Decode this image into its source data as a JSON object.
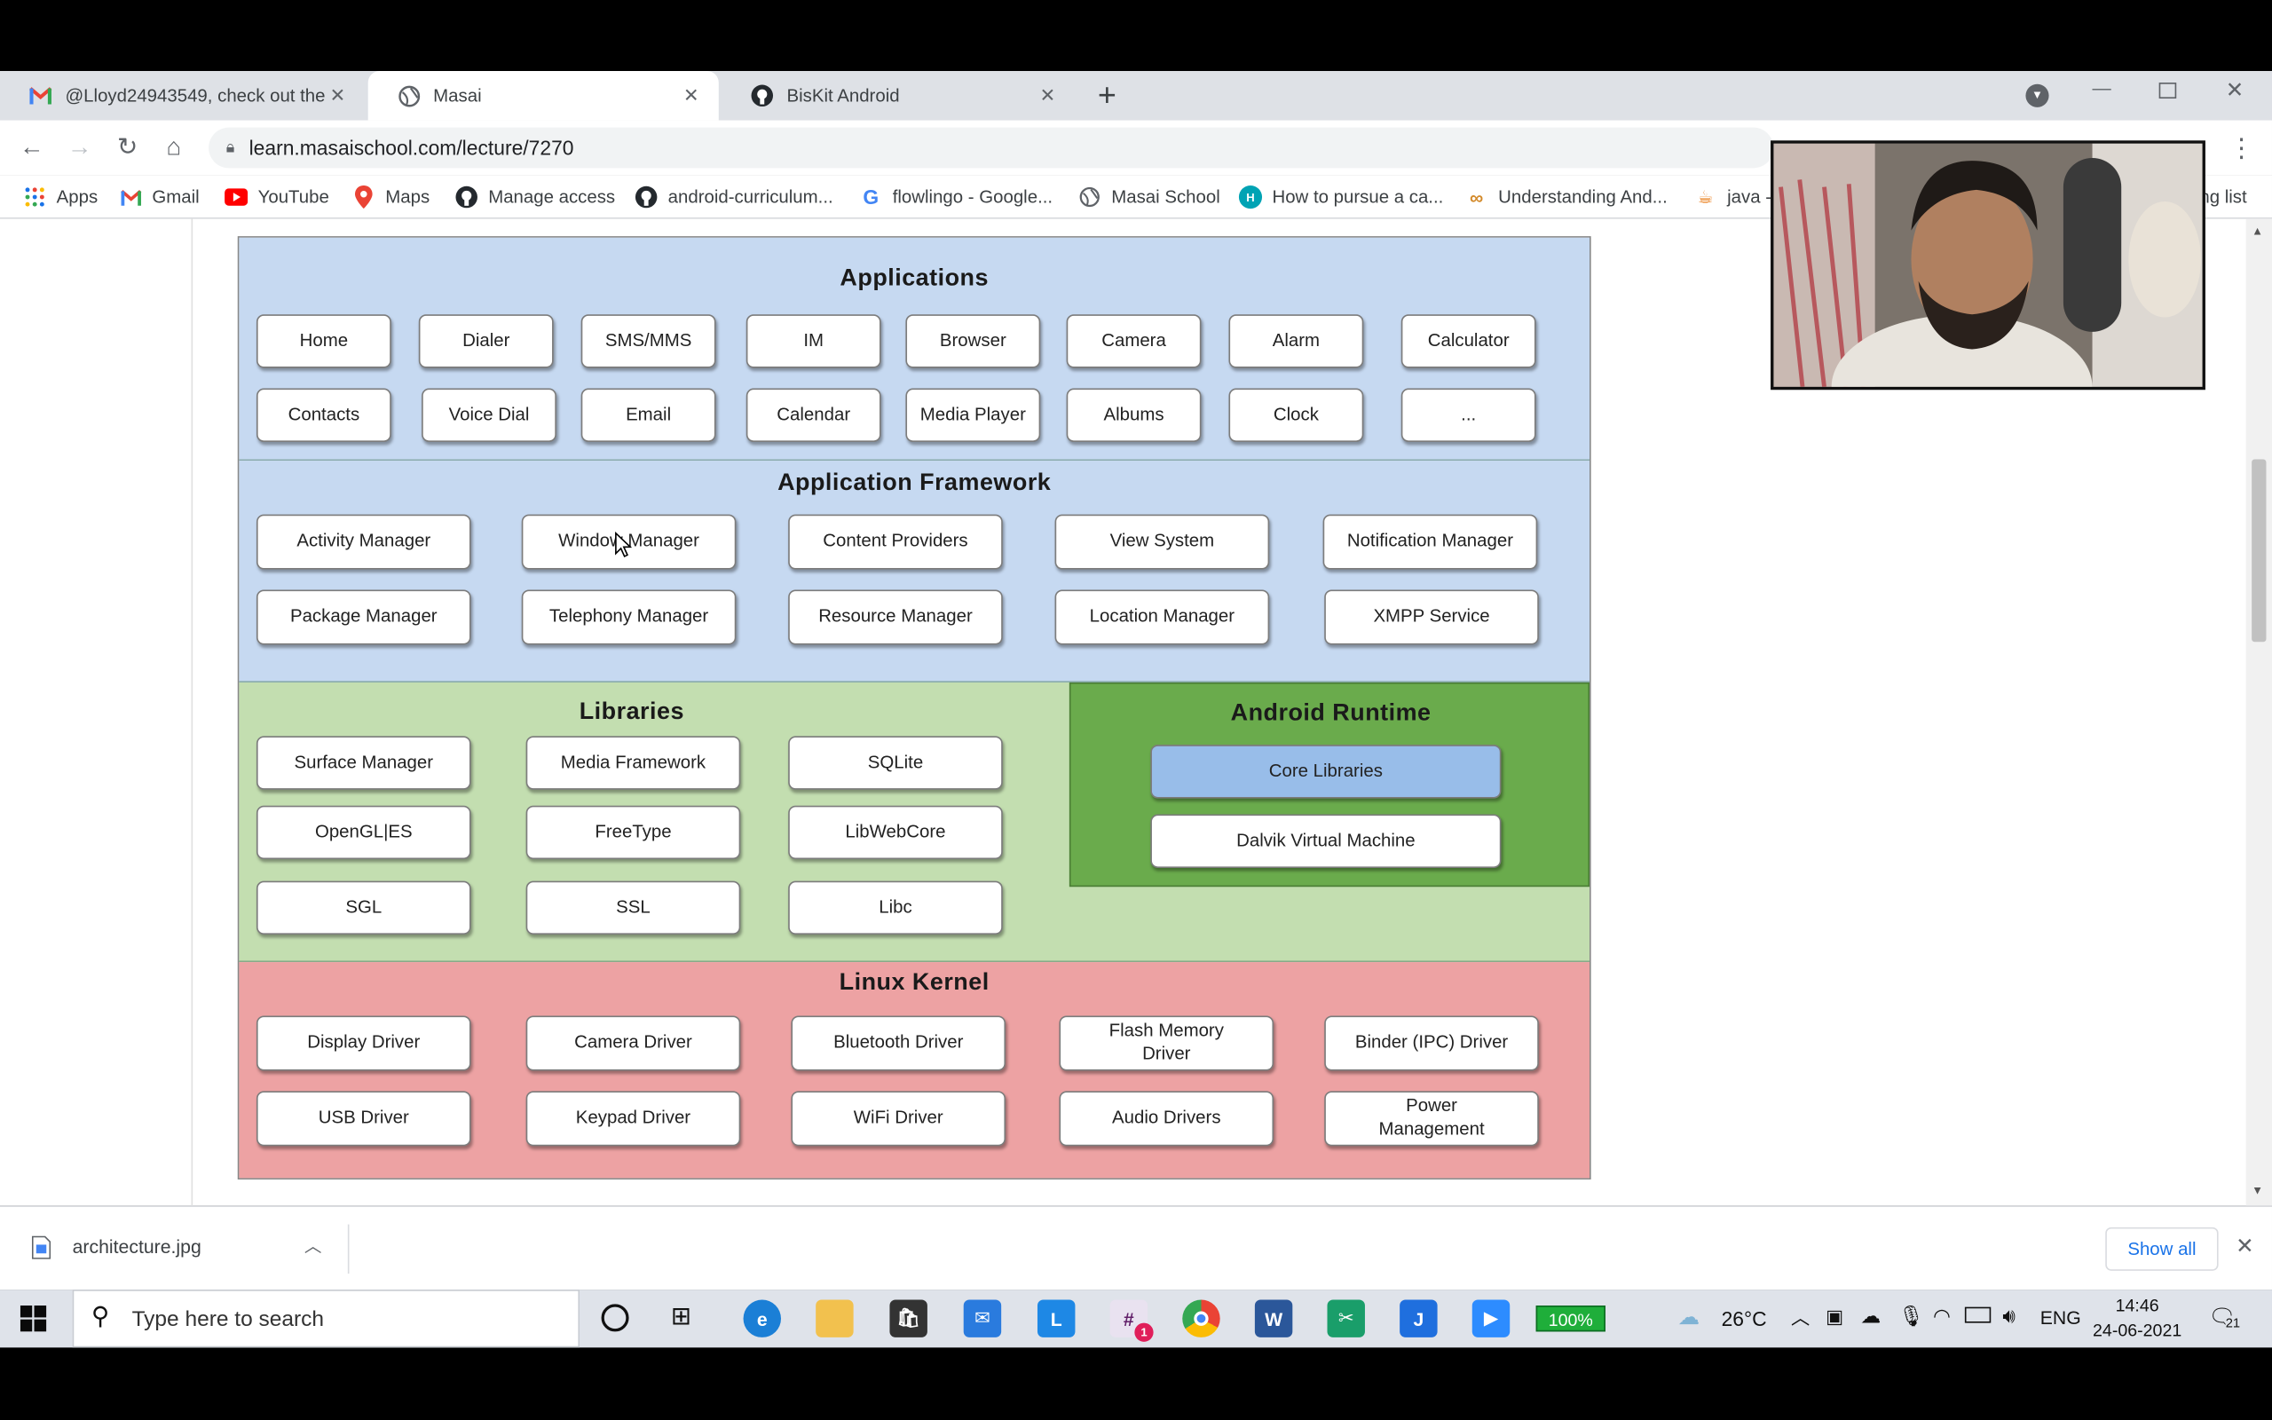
{
  "browser": {
    "tabs": [
      {
        "label": "@Lloyd24943549, check out the",
        "icon": "gmail-icon",
        "active": false
      },
      {
        "label": "Masai",
        "icon": "globe-icon",
        "active": true
      },
      {
        "label": "BisKit Android",
        "icon": "github-icon",
        "active": false
      }
    ],
    "new_tab_symbol": "+",
    "url": "learn.masaischool.com/lecture/7270",
    "bookmarks": [
      {
        "label": "Apps",
        "icon": "apps-grid-icon"
      },
      {
        "label": "Gmail",
        "icon": "gmail-icon"
      },
      {
        "label": "YouTube",
        "icon": "youtube-icon"
      },
      {
        "label": "Maps",
        "icon": "maps-icon"
      },
      {
        "label": "Manage access",
        "icon": "github-icon"
      },
      {
        "label": "android-curriculum...",
        "icon": "github-icon"
      },
      {
        "label": "flowlingo - Google...",
        "icon": "google-icon"
      },
      {
        "label": "Masai School",
        "icon": "globe-icon"
      },
      {
        "label": "How to pursue a ca...",
        "icon": "hd-icon"
      },
      {
        "label": "Understanding And...",
        "icon": "link-icon"
      },
      {
        "label": "java -",
        "icon": "java-icon"
      }
    ],
    "bookmarks_overflow_label": "ng list"
  },
  "diagram": {
    "applications": {
      "title": "Applications",
      "row1": [
        "Home",
        "Dialer",
        "SMS/MMS",
        "IM",
        "Browser",
        "Camera",
        "Alarm",
        "Calculator"
      ],
      "row2": [
        "Contacts",
        "Voice Dial",
        "Email",
        "Calendar",
        "Media Player",
        "Albums",
        "Clock",
        "..."
      ]
    },
    "framework": {
      "title": "Application Framework",
      "row1": [
        "Activity Manager",
        "Window Manager",
        "Content Providers",
        "View System",
        "Notification Manager"
      ],
      "row2": [
        "Package Manager",
        "Telephony Manager",
        "Resource Manager",
        "Location Manager",
        "XMPP Service"
      ]
    },
    "libraries": {
      "title": "Libraries",
      "items": [
        "Surface Manager",
        "Media Framework",
        "SQLite",
        "OpenGL|ES",
        "FreeType",
        "LibWebCore",
        "SGL",
        "SSL",
        "Libc"
      ]
    },
    "runtime": {
      "title": "Android Runtime",
      "items": [
        "Core Libraries",
        "Dalvik Virtual Machine"
      ]
    },
    "kernel": {
      "title": "Linux Kernel",
      "row1": [
        "Display Driver",
        "Camera Driver",
        "Bluetooth Driver",
        "Flash Memory Driver",
        "Binder (IPC) Driver"
      ],
      "row2": [
        "USB Driver",
        "Keypad Driver",
        "WiFi Driver",
        "Audio Drivers",
        "Power Management"
      ]
    },
    "colors": {
      "applications": "#c6d9f1",
      "framework": "#c6d9f1",
      "libraries": "#c3deb0",
      "runtime": "#6aab4c",
      "kernel": "#eda2a3",
      "core_libraries": "#98bde9"
    }
  },
  "downloads": {
    "file_name": "architecture.jpg",
    "show_all": "Show all"
  },
  "taskbar": {
    "search_placeholder": "Type here to search",
    "battery": "100%",
    "temperature": "26°C",
    "language": "ENG",
    "time": "14:46",
    "date": "24-06-2021",
    "notification_count": "21",
    "slack_badge": "1"
  }
}
